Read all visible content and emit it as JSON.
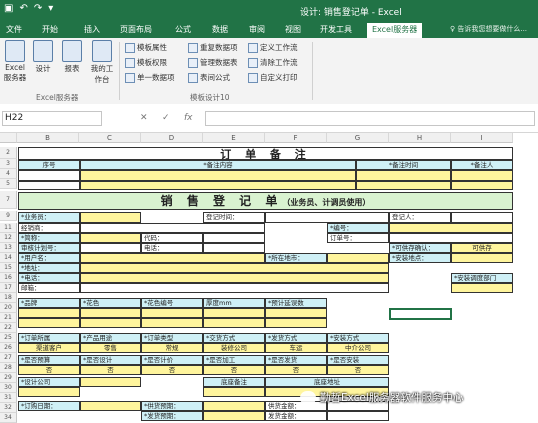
{
  "title": "设计: 销售登记单 - Excel",
  "tabs": [
    "文件",
    "开始",
    "插入",
    "页面布局",
    "公式",
    "数据",
    "审阅",
    "视图",
    "开发工具",
    "Excel服务器"
  ],
  "active_tab": "Excel服务器",
  "tell_me": "告诉我您想要做什么...",
  "ribbon": {
    "big": [
      "Excel服务器",
      "设计",
      "报表",
      "我的工作台"
    ],
    "small": [
      "模板属性",
      "重复数据项",
      "定义工作流",
      "模板权限",
      "管理数据表",
      "清除工作流",
      "单一数据项",
      "表间公式",
      "自定义打印"
    ],
    "group1": "Excel服务器",
    "group2": "模板设计10"
  },
  "namebox": "H22",
  "fx": {
    "cancel": "✕",
    "ok": "✓",
    "fx": "fx"
  },
  "columns": [
    "B",
    "C",
    "D",
    "E",
    "F",
    "G",
    "H",
    "I"
  ],
  "rows": [
    "2",
    "3",
    "4",
    "5",
    "7",
    "9",
    "11",
    "12",
    "13",
    "14",
    "15",
    "16",
    "17",
    "18",
    "20",
    "21",
    "22",
    "25",
    "26",
    "27",
    "28",
    "29",
    "30",
    "31",
    "32",
    "34",
    "35",
    "36"
  ],
  "sheet": {
    "order_title": "订 单 备 注",
    "r3": [
      "序号",
      "*备注内容",
      "*备注时间",
      "*备注人"
    ],
    "sales_title": "销 售 登 记 单",
    "sales_sub": "（业务员、计调员使用）",
    "r9": [
      "*业务员：",
      "登记时间：",
      "登记人："
    ],
    "r11": [
      "经销商：",
      "*编号："
    ],
    "r12": [
      "*简称：",
      "代码：",
      "订单号："
    ],
    "r13": [
      "审核计划号：",
      "电话：",
      "*可供存确认：",
      "可供存"
    ],
    "r14": [
      "*用户名：",
      "*所在地市：",
      "*安装地点："
    ],
    "r15": [
      "*地址："
    ],
    "r16": [
      "*电话：",
      "*安装调度部门"
    ],
    "r17": [
      "邮箱："
    ],
    "r20": [
      "*品牌",
      "*花色",
      "*花色编号",
      "厚度mm",
      "*预计延误数"
    ],
    "r25": [
      "*订单所属",
      "*产品用途",
      "*订单类型",
      "*交货方式",
      "*发货方式",
      "*安装方式"
    ],
    "r26": [
      "渠道客户",
      "零售",
      "常规",
      "装修公司",
      "车运",
      "中介公司"
    ],
    "r28": [
      "*是否预算",
      "*是否设计",
      "*是否计价",
      "*是否加工",
      "*是否发货",
      "*是否安装"
    ],
    "r29": [
      "否",
      "否",
      "否",
      "否",
      "否",
      "否"
    ],
    "r31": [
      "*设计公司",
      "底座备注",
      "底座地址"
    ],
    "r34": [
      "*订购日期：",
      "*供货预期：",
      "供货金额："
    ],
    "r35": [
      "",
      "*发货预期：",
      "发货金额："
    ],
    "r36": [
      "",
      "*安装预期：",
      "安装金额："
    ]
  },
  "watermark": "勤哲Excel服务器软件服务中心"
}
